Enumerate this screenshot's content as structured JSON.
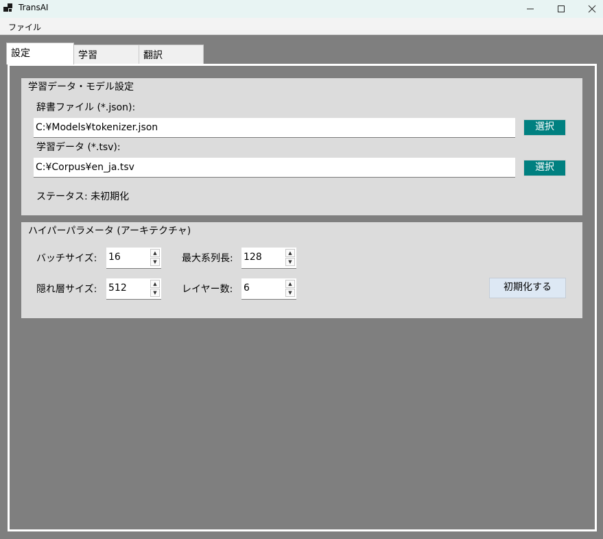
{
  "window": {
    "title": "TransAI",
    "minimize_glyph": "─",
    "maximize_glyph": "□",
    "close_glyph": "✕"
  },
  "menu": {
    "file_label": "ファイル"
  },
  "tabs": [
    {
      "label": "設定",
      "active": true
    },
    {
      "label": "学習",
      "active": false
    },
    {
      "label": "翻訳",
      "active": false
    }
  ],
  "data_group": {
    "title": "学習データ・モデル設定",
    "dict_label": "辞書ファイル (*.json):",
    "dict_path": "C:¥Models¥tokenizer.json",
    "select_label": "選択",
    "train_label": "学習データ (*.tsv):",
    "train_path": "C:¥Corpus¥en_ja.tsv",
    "status_text": "ステータス: 未初期化"
  },
  "hyper_group": {
    "title": "ハイパーパラメータ (アーキテクチャ)",
    "batch_label": "バッチサイズ:",
    "batch_value": "16",
    "maxlen_label": "最大系列長:",
    "maxlen_value": "128",
    "hidden_label": "隠れ層サイズ:",
    "hidden_value": "512",
    "layers_label": "レイヤー数:",
    "layers_value": "6",
    "init_label": "初期化する"
  },
  "colors": {
    "select_button": "#008080",
    "init_button": "#dde8f4",
    "panel": "#dcdcdc",
    "background": "#7f7f7f"
  }
}
